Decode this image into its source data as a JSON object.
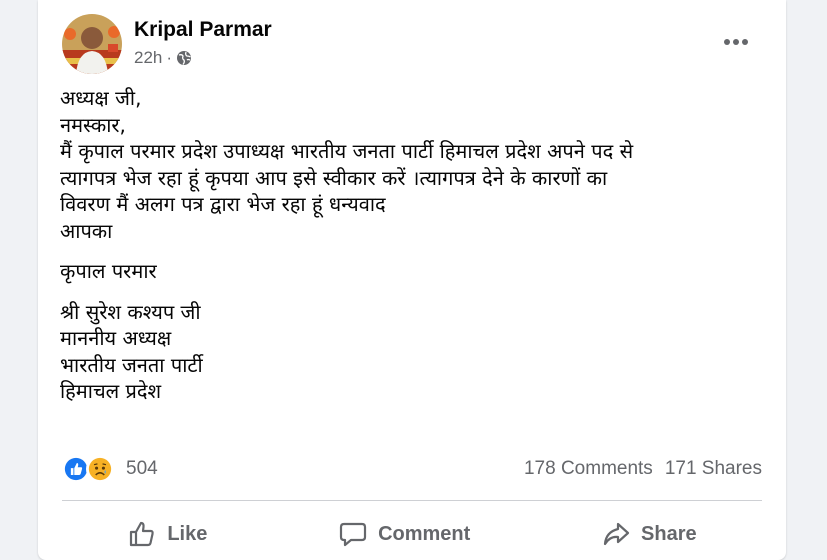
{
  "post": {
    "author": "Kripal Parmar",
    "time": "22h",
    "separator": "·",
    "audience_icon": "globe-icon",
    "menu_icon": "more-horizontal-icon",
    "message_lines": [
      "अध्यक्ष जी,",
      "नमस्कार,",
      "मैं कृपाल परमार प्रदेश उपाध्यक्ष भारतीय जनता पार्टी हिमाचल प्रदेश अपने पद से",
      "त्यागपत्र भेज रहा हूं कृपया आप इसे स्वीकार करें ।त्यागपत्र देने के कारणों का",
      "विवरण मैं अलग पत्र द्वारा भेज रहा हूं धन्यवाद",
      "आपका"
    ],
    "signature": "कृपाल परमार",
    "recipient_lines": [
      "श्री सुरेश कश्यप जी",
      "माननीय अध्यक्ष",
      "भारतीय जनता पार्टी",
      "हिमाचल प्रदेश"
    ]
  },
  "stats": {
    "reaction_icons": [
      "like-reaction-icon",
      "sad-reaction-icon"
    ],
    "reaction_count": "504",
    "comments": "178 Comments",
    "shares": "171 Shares"
  },
  "actions": {
    "like": "Like",
    "comment": "Comment",
    "share": "Share"
  },
  "colors": {
    "like_blue": "#1877f2",
    "sad_yellow": "#f7b125",
    "secondary_text": "#65676b",
    "primary_text": "#050505"
  }
}
